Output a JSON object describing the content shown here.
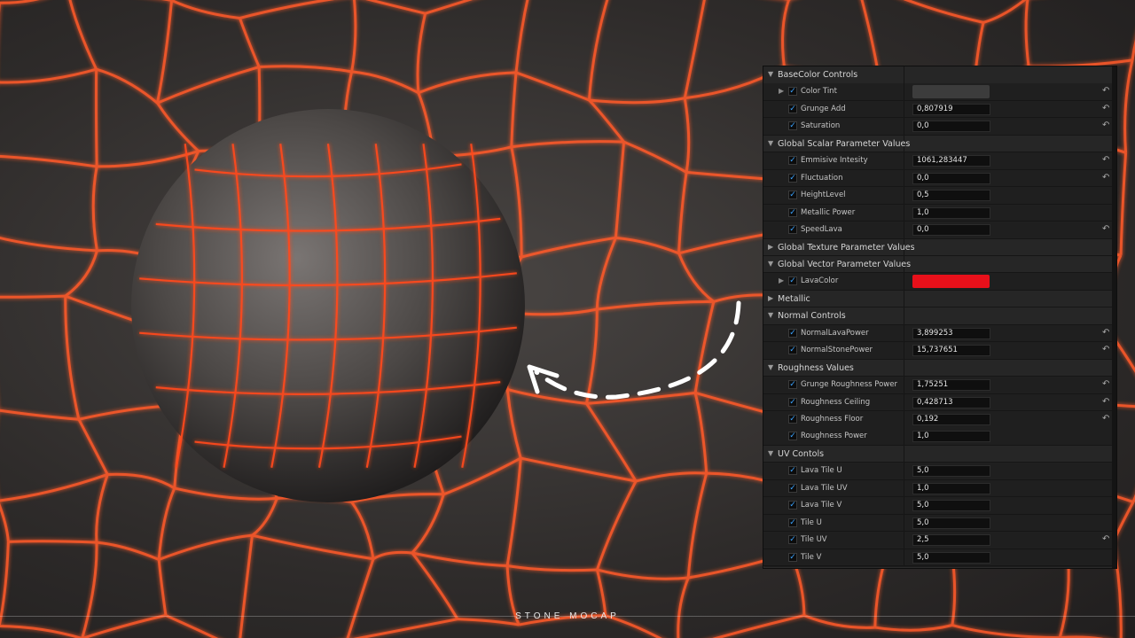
{
  "colors": {
    "lava": "#ff5a2a",
    "accent_check": "#3aa3ff",
    "lava_swatch": "#e8101a",
    "color_tint_swatch": "#3c3c3c"
  },
  "watermark": "STONE MOCAP",
  "rows": [
    {
      "type": "category",
      "label": "BaseColor Controls",
      "expanded": true
    },
    {
      "type": "property",
      "label": "Color Tint",
      "swatch": "#3c3c3c",
      "expandable": true,
      "reset": true
    },
    {
      "type": "property",
      "label": "Grunge Add",
      "value": "0,807919",
      "reset": true
    },
    {
      "type": "property",
      "label": "Saturation",
      "value": "0,0",
      "reset": true
    },
    {
      "type": "category",
      "label": "Global Scalar Parameter Values",
      "expanded": true
    },
    {
      "type": "property",
      "label": "Emmisive Intesity",
      "value": "1061,283447",
      "reset": true
    },
    {
      "type": "property",
      "label": "Fluctuation",
      "value": "0,0",
      "reset": true
    },
    {
      "type": "property",
      "label": "HeightLevel",
      "value": "0,5",
      "reset": false
    },
    {
      "type": "property",
      "label": "Metallic Power",
      "value": "1,0",
      "reset": false
    },
    {
      "type": "property",
      "label": "SpeedLava",
      "value": "0,0",
      "reset": true
    },
    {
      "type": "category",
      "label": "Global Texture Parameter Values",
      "expanded": false
    },
    {
      "type": "category",
      "label": "Global Vector Parameter Values",
      "expanded": true
    },
    {
      "type": "property",
      "label": "LavaColor",
      "swatch": "#e8101a",
      "expandable": true,
      "reset": false
    },
    {
      "type": "category",
      "label": "Metallic",
      "expanded": false
    },
    {
      "type": "category",
      "label": "Normal Controls",
      "expanded": true
    },
    {
      "type": "property",
      "label": "NormalLavaPower",
      "value": "3,899253",
      "reset": true
    },
    {
      "type": "property",
      "label": "NormalStonePower",
      "value": "15,737651",
      "reset": true
    },
    {
      "type": "category",
      "label": "Roughness Values",
      "expanded": true
    },
    {
      "type": "property",
      "label": "Grunge Roughness Power",
      "value": "1,75251",
      "reset": true
    },
    {
      "type": "property",
      "label": "Roughness Ceiling",
      "value": "0,428713",
      "reset": true
    },
    {
      "type": "property",
      "label": "Roughness Floor",
      "value": "0,192",
      "reset": true
    },
    {
      "type": "property",
      "label": "Roughness Power",
      "value": "1,0",
      "reset": false
    },
    {
      "type": "category",
      "label": "UV Contols",
      "expanded": true
    },
    {
      "type": "property",
      "label": "Lava Tile U",
      "value": "5,0",
      "reset": false
    },
    {
      "type": "property",
      "label": "Lava Tile UV",
      "value": "1,0",
      "reset": false
    },
    {
      "type": "property",
      "label": "Lava Tile V",
      "value": "5,0",
      "reset": false
    },
    {
      "type": "property",
      "label": "Tile U",
      "value": "5,0",
      "reset": false
    },
    {
      "type": "property",
      "label": "Tile UV",
      "value": "2,5",
      "reset": true
    },
    {
      "type": "property",
      "label": "Tile V",
      "value": "5,0",
      "reset": false
    }
  ]
}
